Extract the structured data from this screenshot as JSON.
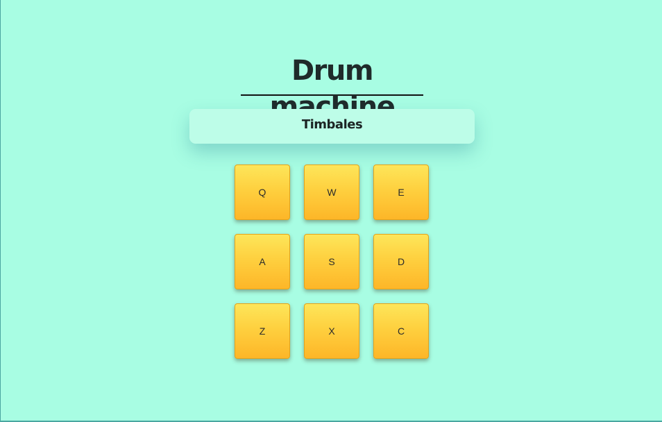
{
  "page": {
    "title": "Drum machine",
    "display_text": "Timbales"
  },
  "pads": [
    {
      "key": "Q"
    },
    {
      "key": "W"
    },
    {
      "key": "E"
    },
    {
      "key": "A"
    },
    {
      "key": "S"
    },
    {
      "key": "D"
    },
    {
      "key": "Z"
    },
    {
      "key": "X"
    },
    {
      "key": "C"
    }
  ],
  "colors": {
    "background": "#a8fde3",
    "display_background": "#bdfde8",
    "pad_top": "#fde65a",
    "pad_bottom": "#fdb628",
    "title_text": "#1f2a2a"
  }
}
